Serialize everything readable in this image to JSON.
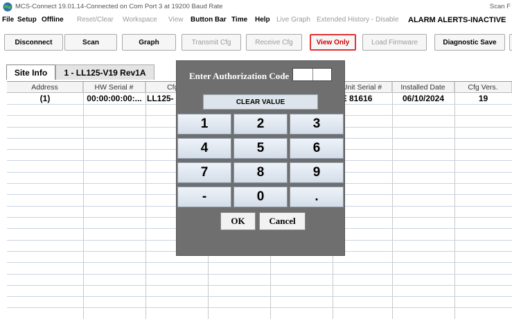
{
  "window": {
    "title": "MCS-Connect 19.01.14-Connected on Com Port 3 at 19200 Baud Rate",
    "title_right": "Scan F"
  },
  "menu": {
    "file": "File",
    "setup": "Setup",
    "offline": "Offline",
    "reset_clear": "Reset/Clear",
    "workspace": "Workspace",
    "view": "View",
    "button_bar": "Button Bar",
    "time": "Time",
    "help": "Help",
    "live_graph": "Live Graph",
    "extended_history": "Extended History - Disable",
    "alarm_alerts": "ALARM ALERTS-INACTIVE"
  },
  "toolbar": {
    "disconnect": "Disconnect",
    "scan": "Scan",
    "graph": "Graph",
    "transmit_cfg": "Transmit Cfg",
    "receive_cfg": "Receive Cfg",
    "view_only": "View Only",
    "load_firmware": "Load Firmware",
    "diagnostic_save": "Diagnostic Save"
  },
  "tabs": {
    "site_info": "Site Info",
    "unit": "1 - LL125-V19 Rev1A"
  },
  "table": {
    "headers": [
      "Address",
      "HW Serial #",
      "Cfg N",
      "",
      "",
      "Unit Serial #",
      "Installed Date",
      "Cfg Vers."
    ],
    "rows": [
      [
        "(1)",
        "00:00:00:00:...",
        "LL125-",
        "",
        "",
        "HE 81616",
        "06/10/2024",
        "19"
      ]
    ]
  },
  "dialog": {
    "title": "Enter Authorization Code",
    "code_value": "",
    "clear_value": "CLEAR VALUE",
    "keys": [
      "1",
      "2",
      "3",
      "4",
      "5",
      "6",
      "7",
      "8",
      "9",
      "-",
      "0",
      "."
    ],
    "ok": "OK",
    "cancel": "Cancel"
  },
  "colors": {
    "dialog_bg": "#6f6f6f",
    "view_only_border": "#e03030",
    "disabled_text": "#9a9a9a"
  }
}
